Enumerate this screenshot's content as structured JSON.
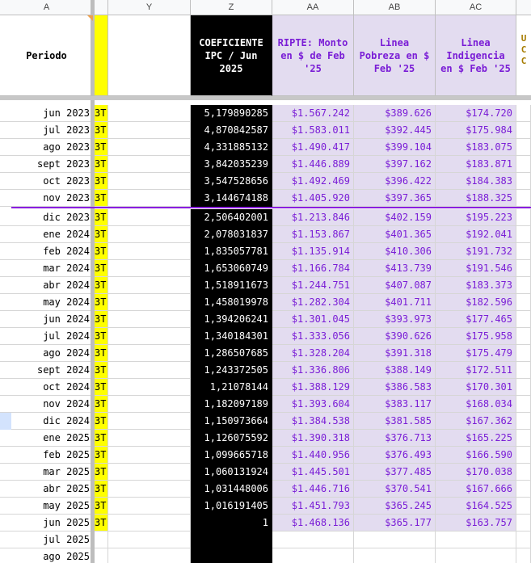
{
  "columns": {
    "a": "A",
    "y": "Y",
    "z": "Z",
    "aa": "AA",
    "ab": "AB",
    "ac": "AC"
  },
  "headers": {
    "periodo": "Periodo",
    "coef_line1": "COEFICIENTE",
    "coef_line2": "IPC / Jun",
    "coef_line3": "2025",
    "ripte_line1": "RIPTE: Monto",
    "ripte_line2": "en $ de Feb",
    "ripte_line3": "'25",
    "pobreza_line1": "Linea",
    "pobreza_line2": "Pobreza en $",
    "pobreza_line3": "Feb '25",
    "indig_line1": "Linea",
    "indig_line2": "Indigencia",
    "indig_line3": "en $ Feb '25",
    "ad_partial_1": "U",
    "ad_partial_2": "C",
    "ad_partial_3": "C"
  },
  "x_fragment": "3T",
  "rows": [
    {
      "periodo": "jun 2023",
      "coef": "5,179890285",
      "ripte": "$1.567.242",
      "pobreza": "$389.626",
      "indig": "$174.720"
    },
    {
      "periodo": "jul 2023",
      "coef": "4,870842587",
      "ripte": "$1.583.011",
      "pobreza": "$392.445",
      "indig": "$175.984"
    },
    {
      "periodo": "ago 2023",
      "coef": "4,331885132",
      "ripte": "$1.490.417",
      "pobreza": "$399.104",
      "indig": "$183.075"
    },
    {
      "periodo": "sept 2023",
      "coef": "3,842035239",
      "ripte": "$1.446.889",
      "pobreza": "$397.162",
      "indig": "$183.871"
    },
    {
      "periodo": "oct 2023",
      "coef": "3,547528656",
      "ripte": "$1.492.469",
      "pobreza": "$396.422",
      "indig": "$184.383"
    },
    {
      "periodo": "nov 2023",
      "coef": "3,144674188",
      "ripte": "$1.405.920",
      "pobreza": "$397.365",
      "indig": "$188.325"
    },
    {
      "periodo": "dic 2023",
      "coef": "2,506402001",
      "ripte": "$1.213.846",
      "pobreza": "$402.159",
      "indig": "$195.223"
    },
    {
      "periodo": "ene 2024",
      "coef": "2,078031837",
      "ripte": "$1.153.867",
      "pobreza": "$401.365",
      "indig": "$192.041"
    },
    {
      "periodo": "feb 2024",
      "coef": "1,835057781",
      "ripte": "$1.135.914",
      "pobreza": "$410.306",
      "indig": "$191.732"
    },
    {
      "periodo": "mar 2024",
      "coef": "1,653060749",
      "ripte": "$1.166.784",
      "pobreza": "$413.739",
      "indig": "$191.546"
    },
    {
      "periodo": "abr 2024",
      "coef": "1,518911673",
      "ripte": "$1.244.751",
      "pobreza": "$407.087",
      "indig": "$183.373"
    },
    {
      "periodo": "may 2024",
      "coef": "1,458019978",
      "ripte": "$1.282.304",
      "pobreza": "$401.711",
      "indig": "$182.596"
    },
    {
      "periodo": "jun 2024",
      "coef": "1,394206241",
      "ripte": "$1.301.045",
      "pobreza": "$393.973",
      "indig": "$177.465"
    },
    {
      "periodo": "jul 2024",
      "coef": "1,340184301",
      "ripte": "$1.333.056",
      "pobreza": "$390.626",
      "indig": "$175.958"
    },
    {
      "periodo": "ago 2024",
      "coef": "1,286507685",
      "ripte": "$1.328.204",
      "pobreza": "$391.318",
      "indig": "$175.479"
    },
    {
      "periodo": "sept 2024",
      "coef": "1,243372505",
      "ripte": "$1.336.806",
      "pobreza": "$388.149",
      "indig": "$172.511"
    },
    {
      "periodo": "oct 2024",
      "coef": "1,21078144",
      "ripte": "$1.388.129",
      "pobreza": "$386.583",
      "indig": "$170.301"
    },
    {
      "periodo": "nov 2024",
      "coef": "1,182097189",
      "ripte": "$1.393.604",
      "pobreza": "$383.117",
      "indig": "$168.034"
    },
    {
      "periodo": "dic 2024",
      "coef": "1,150973664",
      "ripte": "$1.384.538",
      "pobreza": "$381.585",
      "indig": "$167.362"
    },
    {
      "periodo": "ene 2025",
      "coef": "1,126075592",
      "ripte": "$1.390.318",
      "pobreza": "$376.713",
      "indig": "$165.225"
    },
    {
      "periodo": "feb 2025",
      "coef": "1,099665718",
      "ripte": "$1.440.956",
      "pobreza": "$376.493",
      "indig": "$166.590"
    },
    {
      "periodo": "mar 2025",
      "coef": "1,060131924",
      "ripte": "$1.445.501",
      "pobreza": "$377.485",
      "indig": "$170.038"
    },
    {
      "periodo": "abr 2025",
      "coef": "1,031448006",
      "ripte": "$1.446.716",
      "pobreza": "$370.541",
      "indig": "$167.666"
    },
    {
      "periodo": "may 2025",
      "coef": "1,016191405",
      "ripte": "$1.451.793",
      "pobreza": "$365.245",
      "indig": "$164.525"
    },
    {
      "periodo": "jun 2025",
      "coef": "1",
      "ripte": "$1.468.136",
      "pobreza": "$365.177",
      "indig": "$163.757"
    },
    {
      "periodo": "jul 2025",
      "coef": "",
      "ripte": "",
      "pobreza": "",
      "indig": ""
    },
    {
      "periodo": "ago 2025",
      "coef": "",
      "ripte": "",
      "pobreza": "",
      "indig": ""
    }
  ],
  "colors": {
    "yellow_column": "#ffff00",
    "coef_column_bg": "#000000",
    "lavender_bg": "#e3dcf0",
    "purple_text": "#7a1dd6",
    "divider_line": "#8a1ee0"
  }
}
